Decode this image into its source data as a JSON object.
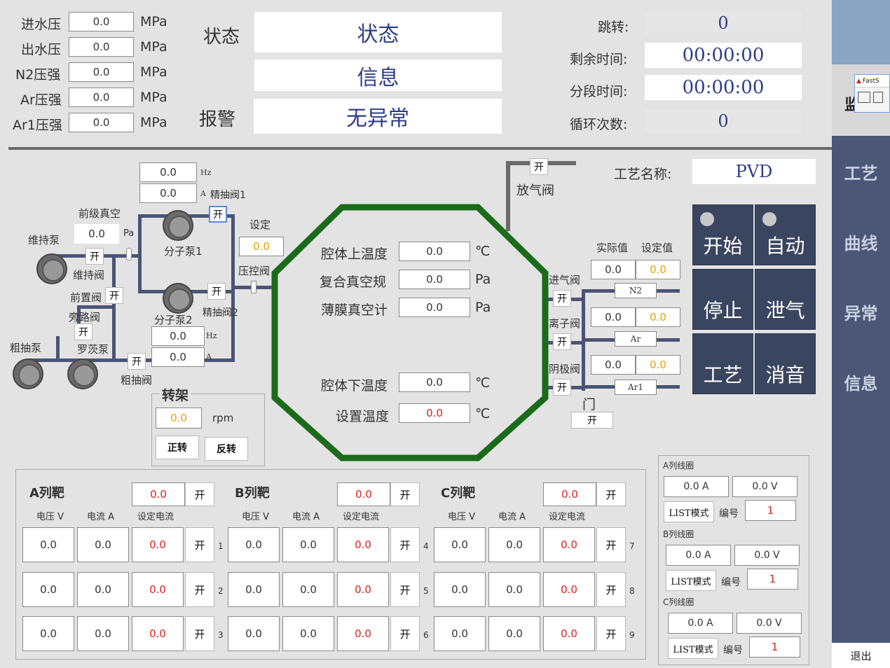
{
  "pressures": [
    {
      "label": "进水压",
      "value": "0.0",
      "unit": "MPa"
    },
    {
      "label": "出水压",
      "value": "0.0",
      "unit": "MPa"
    },
    {
      "label": "N2压强",
      "value": "0.0",
      "unit": "MPa"
    },
    {
      "label": "Ar压强",
      "value": "0.0",
      "unit": "MPa"
    },
    {
      "label": "Ar1压强",
      "value": "0.0",
      "unit": "MPa"
    }
  ],
  "status": {
    "label": "状态",
    "value": "状态",
    "info": "信息",
    "alarm_label": "报警",
    "alarm_value": "无异常"
  },
  "timers": [
    {
      "label": "跳转:",
      "value": "0"
    },
    {
      "label": "剩余时间:",
      "value": "00:00:00"
    },
    {
      "label": "分段时间:",
      "value": "00:00:00"
    },
    {
      "label": "循环次数:",
      "value": "0"
    }
  ],
  "process": {
    "label": "工艺名称:",
    "value": "PVD"
  },
  "vacuum": {
    "rough_pump": "粗抽泵",
    "roots_pump": "罗茨泵",
    "holding_pump": "维持泵",
    "holding_valve": "维持阀",
    "pre_vacuum_label": "前级真空",
    "pre_vacuum_value": "0.0",
    "pre_vacuum_unit": "Pa",
    "pre_valve": "前置阀",
    "bypass_valve": "旁路阀",
    "rough_valve": "粗抽阀",
    "mol_pump1": "分子泵1",
    "mol_pump2": "分子泵2",
    "fine_valve1": "精抽阀1",
    "fine_valve2": "精抽阀2",
    "mp1_hz": "0.0",
    "mp1_a": "0.0",
    "mp2_hz": "0.0",
    "mp2_a": "0.0",
    "hz": "Hz",
    "a": "A",
    "set_label": "设定",
    "set_value": "0.0",
    "throttle_valve": "压控阀",
    "vent_valve": "放气阀",
    "open": "开"
  },
  "chamber": [
    {
      "label": "腔体上温度",
      "value": "0.0",
      "unit": "℃"
    },
    {
      "label": "复合真空规",
      "value": "0.0",
      "unit": "Pa"
    },
    {
      "label": "薄膜真空计",
      "value": "0.0",
      "unit": "Pa"
    },
    {
      "label": "腔体下温度",
      "value": "0.0",
      "unit": "℃"
    },
    {
      "label": "设置温度",
      "value": "0.0",
      "unit": "℃"
    }
  ],
  "gas": {
    "actual_label": "实际值",
    "set_label": "设定值",
    "inlet_valve": "进气阀",
    "ion_valve": "离子阀",
    "cathode_valve": "阴极阀",
    "door": "门",
    "lines": [
      {
        "name": "N2",
        "actual": "0.0",
        "set": "0.0"
      },
      {
        "name": "Ar",
        "actual": "0.0",
        "set": "0.0"
      },
      {
        "name": "Ar1",
        "actual": "0.0",
        "set": "0.0"
      }
    ]
  },
  "controls": {
    "start": "开始",
    "auto": "自动",
    "stop": "停止",
    "vent": "泄气",
    "process": "工艺",
    "mute": "消音"
  },
  "turntable": {
    "title": "转架",
    "value": "0.0",
    "unit": "rpm",
    "forward": "正转",
    "reverse": "反转"
  },
  "targets": {
    "col_voltage": "电压 V",
    "col_current": "电流 A",
    "col_set": "设定电流",
    "groups": [
      {
        "name": "A列靶",
        "set": "0.0",
        "rows": [
          {
            "v": "0.0",
            "a": "0.0",
            "s": "0.0",
            "n": "1"
          },
          {
            "v": "0.0",
            "a": "0.0",
            "s": "0.0",
            "n": "2"
          },
          {
            "v": "0.0",
            "a": "0.0",
            "s": "0.0",
            "n": "3"
          }
        ]
      },
      {
        "name": "B列靶",
        "set": "0.0",
        "rows": [
          {
            "v": "0.0",
            "a": "0.0",
            "s": "0.0",
            "n": "4"
          },
          {
            "v": "0.0",
            "a": "0.0",
            "s": "0.0",
            "n": "5"
          },
          {
            "v": "0.0",
            "a": "0.0",
            "s": "0.0",
            "n": "6"
          }
        ]
      },
      {
        "name": "C列靶",
        "set": "0.0",
        "rows": [
          {
            "v": "0.0",
            "a": "0.0",
            "s": "0.0",
            "n": "7"
          },
          {
            "v": "0.0",
            "a": "0.0",
            "s": "0.0",
            "n": "8"
          },
          {
            "v": "0.0",
            "a": "0.0",
            "s": "0.0",
            "n": "9"
          }
        ]
      }
    ]
  },
  "coils": [
    {
      "name": "A列线圈",
      "a": "0.0 A",
      "v": "0.0 V",
      "mode": "LIST模式",
      "id_label": "编号",
      "id": "1"
    },
    {
      "name": "B列线圈",
      "a": "0.0 A",
      "v": "0.0 V",
      "mode": "LIST模式",
      "id_label": "编号",
      "id": "1"
    },
    {
      "name": "C列线圈",
      "a": "0.0 A",
      "v": "0.0 V",
      "mode": "LIST模式",
      "id_label": "编号",
      "id": "1"
    }
  ],
  "sidebar": {
    "items": [
      "工艺",
      "曲线",
      "异常",
      "信息"
    ],
    "exit": "退出",
    "popup_title": "FastS"
  }
}
